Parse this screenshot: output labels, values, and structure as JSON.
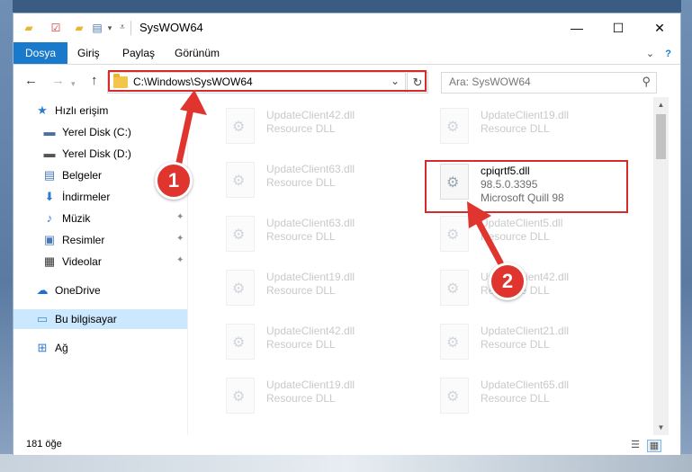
{
  "window": {
    "title": "SysWOW64",
    "quick_access": [
      "folder-icon",
      "checkbox-properties-icon",
      "new-folder-icon",
      "layout-dropdown-icon",
      "customize-arrow-icon"
    ],
    "controls": {
      "minimize": "—",
      "maximize": "☐",
      "close": "✕"
    }
  },
  "ribbon": {
    "tabs": [
      {
        "label": "Dosya",
        "active": true
      },
      {
        "label": "Giriş"
      },
      {
        "label": "Paylaş"
      },
      {
        "label": "Görünüm"
      }
    ],
    "expand": "⌄",
    "help": "?"
  },
  "nav": {
    "back": "←",
    "forward": "→",
    "up": "↑",
    "address": "C:\\Windows\\SysWOW64",
    "refresh": "↻",
    "search_placeholder": "Ara: SysWOW64"
  },
  "sidebar": {
    "items": [
      {
        "label": "Hızlı erişim",
        "icon": "star-icon",
        "glyph": "★",
        "color": "#2c7cd1"
      },
      {
        "label": "Yerel Disk (C:)",
        "icon": "drive-c-icon",
        "glyph": "▬",
        "color": "#4a6fa5"
      },
      {
        "label": "Yerel Disk (D:)",
        "icon": "drive-d-icon",
        "glyph": "▬",
        "color": "#555555"
      },
      {
        "label": "Belgeler",
        "icon": "documents-icon",
        "glyph": "▤",
        "color": "#4a79b5",
        "pinned": true
      },
      {
        "label": "İndirmeler",
        "icon": "downloads-icon",
        "glyph": "⬇",
        "color": "#2c7cd1",
        "pinned": true
      },
      {
        "label": "Müzik",
        "icon": "music-icon",
        "glyph": "♪",
        "color": "#2c7cd1",
        "pinned": true
      },
      {
        "label": "Resimler",
        "icon": "pictures-icon",
        "glyph": "▣",
        "color": "#4a79b5",
        "pinned": true
      },
      {
        "label": "Videolar",
        "icon": "videos-icon",
        "glyph": "▦",
        "color": "#333333",
        "pinned": true
      },
      {
        "label": "OneDrive",
        "icon": "onedrive-icon",
        "glyph": "☁",
        "color": "#1a6fd1"
      },
      {
        "label": "Bu bilgisayar",
        "icon": "computer-icon",
        "glyph": "▭",
        "color": "#3b8fd1",
        "selected": true
      },
      {
        "label": "Ağ",
        "icon": "network-icon",
        "glyph": "⊞",
        "color": "#2c7cd1"
      }
    ],
    "pin_glyph": "📌"
  },
  "files": {
    "col1": [
      {
        "name": "UpdateClient42.dll",
        "type": "Resource DLL"
      },
      {
        "name": "UpdateClient63.dll",
        "type": "Resource DLL"
      },
      {
        "name": "UpdateClient63.dll",
        "type": "Resource DLL"
      },
      {
        "name": "UpdateClient19.dll",
        "type": "Resource DLL"
      },
      {
        "name": "UpdateClient42.dll",
        "type": "Resource DLL"
      },
      {
        "name": "UpdateClient19.dll",
        "type": "Resource DLL"
      }
    ],
    "col2": [
      {
        "name": "UpdateClient19.dll",
        "type": "Resource DLL"
      },
      {
        "name": "UpdateClient5.dll",
        "type": "Resource DLL"
      },
      {
        "name": "UpdateClient42.dll",
        "type": "Resource DLL"
      },
      {
        "name": "UpdateClient21.dll",
        "type": "Resource DLL"
      },
      {
        "name": "UpdateClient65.dll",
        "type": "Resource DLL"
      }
    ],
    "highlighted": {
      "name": "cpiqrtf5.dll",
      "version": "98.5.0.3395",
      "description": "Microsoft Quill 98"
    }
  },
  "status": {
    "count": "181 öğe",
    "view_icons": [
      "details-view-icon",
      "tiles-view-icon"
    ]
  },
  "annotations": {
    "badge1": "1",
    "badge2": "2",
    "color": "#d62b2b"
  }
}
